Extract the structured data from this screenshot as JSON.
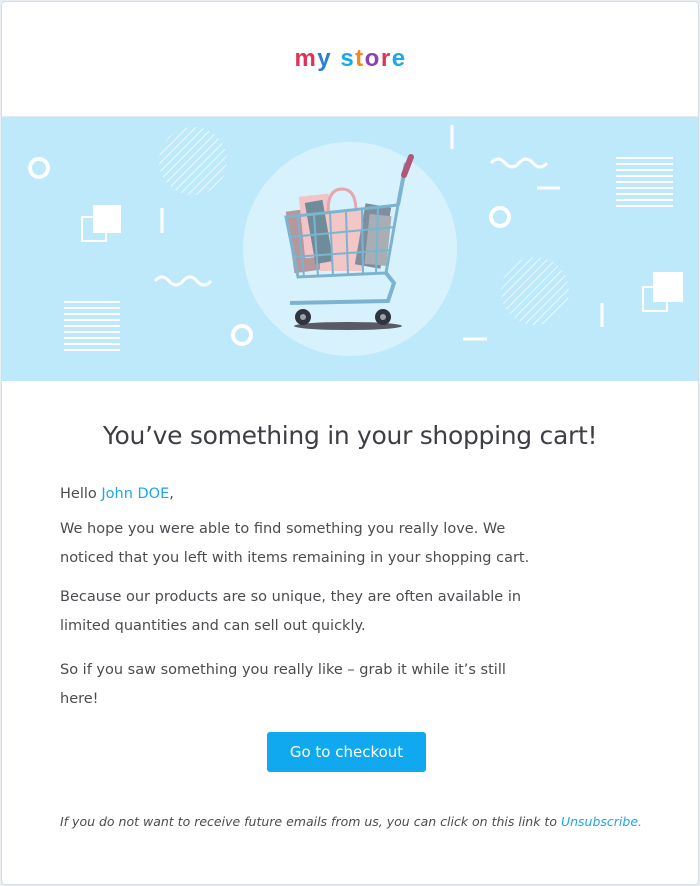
{
  "logo": {
    "letters": [
      "m",
      "y",
      " ",
      "s",
      "t",
      "o",
      "r",
      "e"
    ],
    "colors": [
      "#e0315a",
      "#2a7fd4",
      "#ffffff",
      "#1aa9e8",
      "#f08a1c",
      "#8b3fb8",
      "#e0315a",
      "#1aa9e8"
    ]
  },
  "banner": {
    "background": "#bde9fb",
    "cart_icon": "shopping-cart-icon"
  },
  "headline": "You’ve something in your shopping cart!",
  "body": {
    "greeting_prefix": "Hello ",
    "customer_name": "John DOE",
    "greeting_suffix": ",",
    "paragraph1": "We hope you were able to find something you really love. We noticed that you left with items remaining in your shopping cart.",
    "paragraph2": "Because our products are so unique, they are often available in limited quantities and can sell out quickly.",
    "paragraph3": "So if you saw something you really like – grab it while it’s still here!"
  },
  "cta": {
    "label": "Go to checkout",
    "color": "#10a8ef"
  },
  "footer": {
    "text": "If you do not want to receive future emails from us, you can click on this link to ",
    "link_label": "Unsubscribe.",
    "link_color": "#1ea7e6"
  }
}
